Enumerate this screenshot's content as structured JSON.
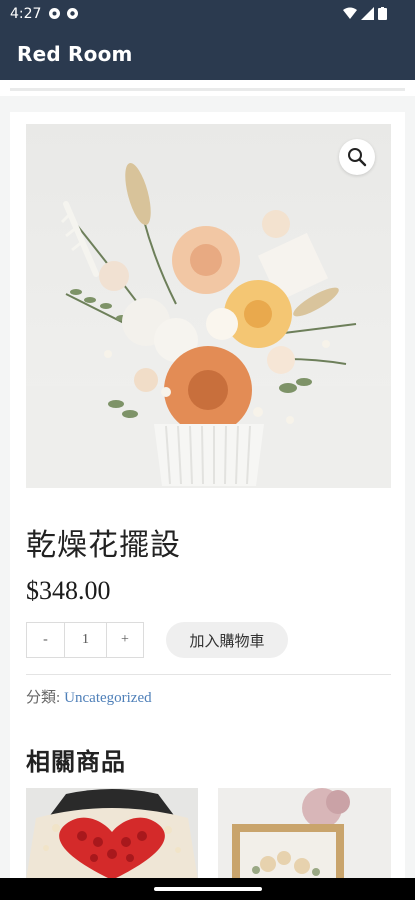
{
  "status_bar": {
    "time": "4:27"
  },
  "app_bar": {
    "title": "Red Room"
  },
  "product": {
    "title": "乾燥花擺設",
    "price": "$348.00",
    "quantity": "1",
    "qty_minus_label": "-",
    "qty_plus_label": "+",
    "add_to_cart_label": "加入購物車",
    "category_label": "分類:",
    "category_value": "Uncategorized"
  },
  "related": {
    "heading": "相關商品"
  },
  "icons": {
    "zoom": "magnifier-icon",
    "status": [
      "settings-icon",
      "settings-icon",
      "wifi-icon",
      "cell-signal-icon",
      "battery-icon"
    ]
  },
  "colors": {
    "app_bar": "#2b3a4f",
    "link": "#4e7fb8"
  }
}
